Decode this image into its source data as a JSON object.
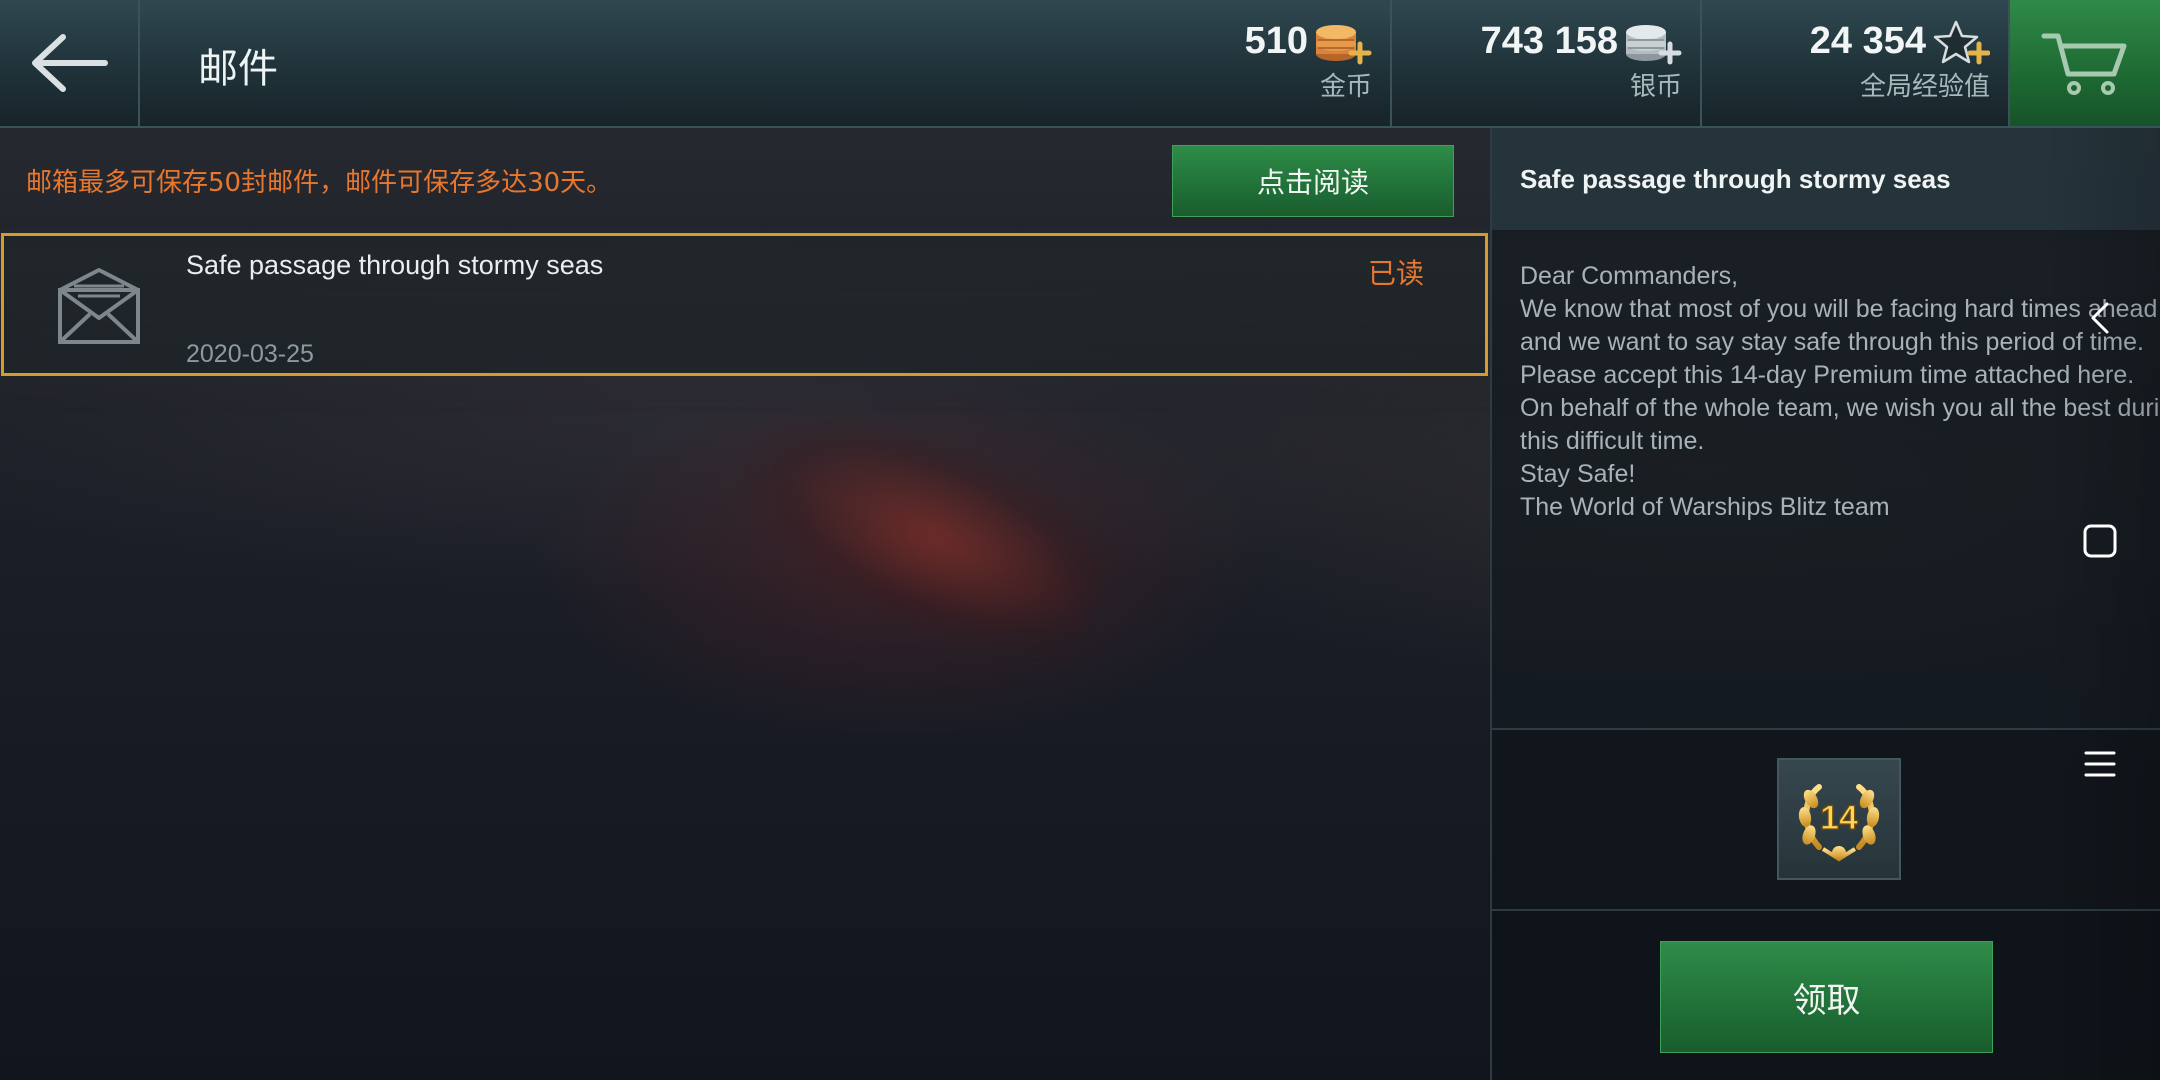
{
  "header": {
    "title": "邮件",
    "currencies": [
      {
        "value": "510",
        "label": "金币",
        "icon": "gold-coins-plus-icon"
      },
      {
        "value": "743 158",
        "label": "银币",
        "icon": "silver-coins-plus-icon"
      },
      {
        "value": "24 354",
        "label": "全局经验值",
        "icon": "star-plus-icon"
      }
    ],
    "cart_icon": "shopping-cart-icon",
    "back_icon": "arrow-left-icon"
  },
  "mailbox": {
    "notice": "邮箱最多可保存50封邮件，邮件可保存多达30天。",
    "read_all_label": "点击阅读",
    "items": [
      {
        "subject": "Safe passage through stormy seas",
        "date": "2020-03-25",
        "status": "已读",
        "icon": "envelope-open-icon"
      }
    ]
  },
  "detail": {
    "title": "Safe passage through stormy seas",
    "body_lines": [
      "Dear Commanders,",
      "We know that most of you will be facing hard times ahead",
      "and we want to say stay safe through this period of time.",
      "Please accept this 14-day Premium time attached here.",
      "On behalf of the whole team, we wish you all the best during",
      "this difficult time.",
      "Stay Safe!",
      "The World of Warships Blitz team"
    ],
    "attachment": {
      "label": "14",
      "icon": "laurel-wreath-icon"
    },
    "claim_label": "领取"
  },
  "system_nav": {
    "icons": [
      "nav-back-icon",
      "nav-home-icon",
      "nav-menu-icon"
    ]
  },
  "colors": {
    "accent_orange": "#e8772e",
    "selected_border": "#d79a2c",
    "button_green": "#207038"
  }
}
